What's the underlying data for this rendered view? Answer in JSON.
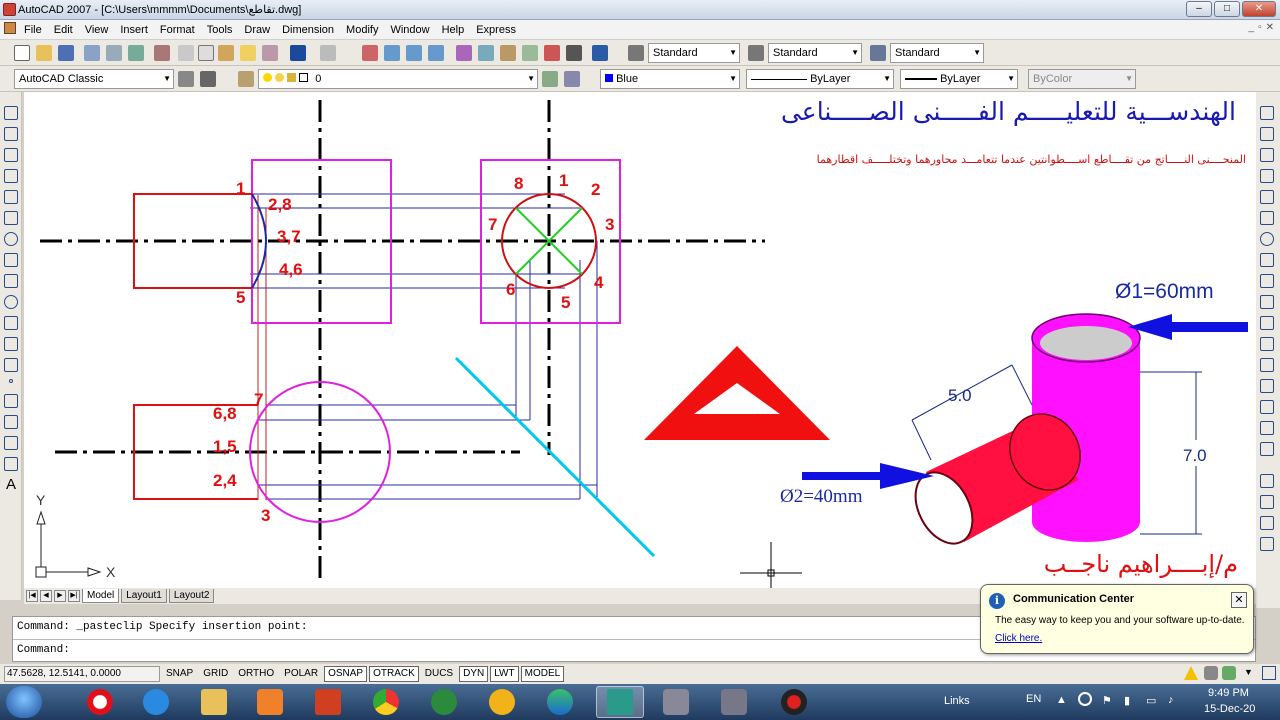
{
  "window": {
    "title": "AutoCAD 2007 - [C:\\Users\\mmmm\\Documents\\تقاطع.dwg]",
    "min": "–",
    "max": "□",
    "close": "✕"
  },
  "menu": [
    "File",
    "Edit",
    "View",
    "Insert",
    "Format",
    "Tools",
    "Draw",
    "Dimension",
    "Modify",
    "Window",
    "Help",
    "Express"
  ],
  "toolbar": {
    "text_style": "Standard",
    "dim_style": "Standard",
    "table_style": "Standard",
    "workspace": "AutoCAD Classic",
    "layer": "0",
    "color": "Blue",
    "color_hex": "#0000ff",
    "linetype": "ByLayer",
    "lineweight": "ByLayer",
    "plotstyle": "ByColor"
  },
  "drawing": {
    "title_ar": "الهندســـية للتعليـــــم الفـــــنى الصـــــناعى",
    "subtitle_ar": "المنحــــنى النـــــاتج من تقــــاطع اســــطوانتين عندما تتعامـــد محاورهما وتختلـــــف اقطارهما",
    "author_ar": "م/إبــــراهيم ناجــب",
    "label_d1": "Ø1=60mm",
    "label_d2": "Ø2=40mm",
    "dim_50": "5.0",
    "dim_70": "7.0",
    "front_labels": [
      "1",
      "2,8",
      "3,7",
      "4,6",
      "5"
    ],
    "side_labels": [
      "8",
      "1",
      "2",
      "3",
      "4",
      "5",
      "6",
      "7"
    ],
    "top_labels": [
      "7",
      "6,8",
      "1,5",
      "2,4",
      "3"
    ],
    "ucs_x": "X",
    "ucs_y": "Y"
  },
  "tabs": [
    "Model",
    "Layout1",
    "Layout2"
  ],
  "command": {
    "line1": "Command:  _pasteclip Specify insertion point:",
    "line2": "Command:"
  },
  "status": {
    "coords": "47.5628, 12.5141, 0.0000",
    "buttons": [
      {
        "label": "SNAP",
        "on": false
      },
      {
        "label": "GRID",
        "on": false
      },
      {
        "label": "ORTHO",
        "on": false
      },
      {
        "label": "POLAR",
        "on": false
      },
      {
        "label": "OSNAP",
        "on": true
      },
      {
        "label": "OTRACK",
        "on": true
      },
      {
        "label": "DUCS",
        "on": false
      },
      {
        "label": "DYN",
        "on": true
      },
      {
        "label": "LWT",
        "on": true
      },
      {
        "label": "MODEL",
        "on": true
      }
    ]
  },
  "popup": {
    "title": "Communication Center",
    "message": "The easy way to keep you and your software up-to-date.",
    "link": "Click here."
  },
  "taskbar": {
    "links": "Links",
    "lang": "EN",
    "time": "9:49 PM",
    "date": "15-Dec-20"
  }
}
